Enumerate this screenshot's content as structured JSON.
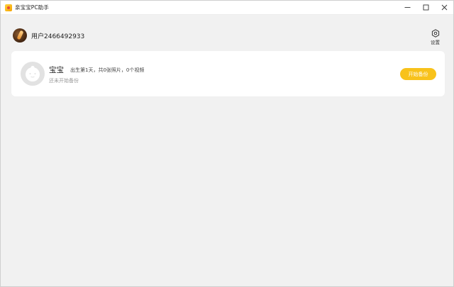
{
  "window": {
    "title": "亲宝宝PC助手",
    "minimize_symbol": "—",
    "maximize_symbol": "☐",
    "close_symbol": "✕"
  },
  "header": {
    "username": "用户2466492933",
    "settings_label": "设置",
    "settings_icon": "hexagon-gear-icon"
  },
  "baby_card": {
    "name": "宝宝",
    "meta": "出生第1天，共0张照片，0个视频",
    "status": "还未开始备份",
    "action_label": "开始备份",
    "accent_color": "#f8c21b"
  }
}
